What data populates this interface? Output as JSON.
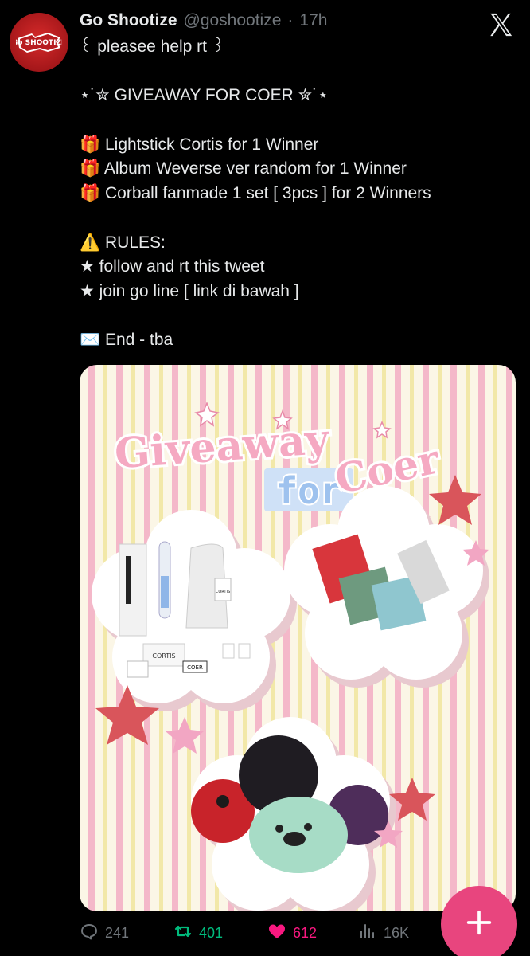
{
  "tweet": {
    "display_name": "Go Shootize",
    "handle": "@goshootize",
    "separator": "·",
    "time": "17h",
    "lines": [
      "꒰ pleasee help rt ꒱",
      "",
      "⋆˙✮ GIVEAWAY FOR COER ✮˙⋆",
      "",
      "🎁 Lightstick Cortis for 1 Winner",
      "🎁 Album Weverse ver random for 1 Winner",
      "🎁 Corball fanmade 1 set [ 3pcs ] for 2 Winners",
      "",
      "⚠️ RULES:",
      "★ follow and rt this tweet",
      "★ join go line [ link di bawah ]",
      "",
      "✉️ End - tba"
    ]
  },
  "avatar": {
    "logo_text": "Go SHOOTIZE"
  },
  "media": {
    "title_top": "Giveaway",
    "title_for": "for",
    "title_coer": "Coer",
    "product_labels": [
      "CORTIS",
      "CORTIS",
      "COER"
    ]
  },
  "actions": {
    "replies": "241",
    "retweets": "401",
    "likes": "612",
    "views": "16K"
  },
  "icons": {
    "reply": "reply-icon",
    "retweet": "retweet-icon",
    "like": "heart-icon",
    "views": "views-icon",
    "compose": "plus-icon",
    "brand": "x-logo-icon"
  },
  "colors": {
    "background": "#000000",
    "text": "#e7e9ea",
    "muted": "#71767b",
    "retweet": "#00ba7c",
    "like": "#f91880",
    "fab": "#e8457e"
  }
}
